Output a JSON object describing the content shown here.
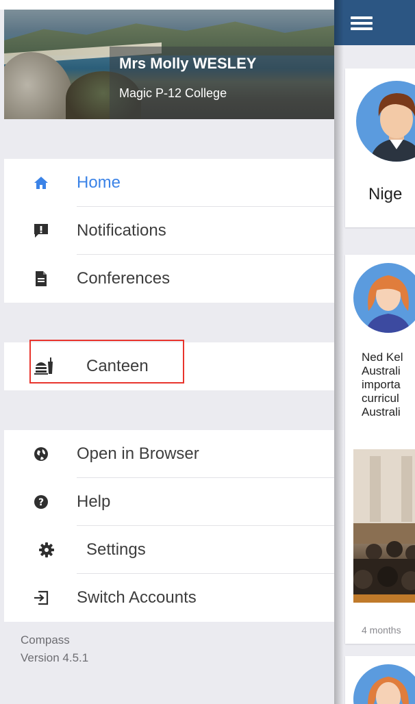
{
  "drawer": {
    "user_name": "Mrs Molly WESLEY",
    "school": "Magic P-12 College",
    "main_items": [
      {
        "label": "Home",
        "icon": "home-icon",
        "active": true
      },
      {
        "label": "Notifications",
        "icon": "notification-icon",
        "active": false
      },
      {
        "label": "Conferences",
        "icon": "document-icon",
        "active": false
      }
    ],
    "canteen_item": {
      "label": "Canteen",
      "icon": "canteen-icon"
    },
    "extra_items": [
      {
        "label": "Open in Browser",
        "icon": "globe-icon"
      },
      {
        "label": "Help",
        "icon": "help-icon"
      },
      {
        "label": "Settings",
        "icon": "gear-icon"
      },
      {
        "label": "Switch Accounts",
        "icon": "switch-account-icon"
      }
    ],
    "footer": {
      "app_name": "Compass",
      "version": "Version 4.5.1"
    }
  },
  "colors": {
    "accent": "#3b83e7",
    "highlight_border": "#e8342c",
    "top_bar": "#2c5683"
  },
  "content": {
    "profile_name": "Nige",
    "post_text": [
      "Ned Kel",
      "Australi",
      "importa",
      "curricul",
      "Australi"
    ],
    "post_time": "4 months"
  }
}
